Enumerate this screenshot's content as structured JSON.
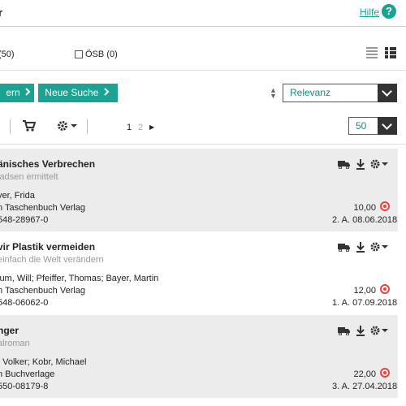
{
  "header": {
    "title": "r",
    "help_link": "Hilfe",
    "help_icon": "?"
  },
  "filters": {
    "first_count": "(50)",
    "osb_label": "ÖSB (0)"
  },
  "actions": {
    "weiter_label": "ern",
    "neue_suche_label": "Neue Suche"
  },
  "sort": {
    "selected": "Relevanz"
  },
  "toolbar": {
    "page_1": "1",
    "page_2": "2",
    "per_page": "50"
  },
  "results": [
    {
      "title": "änisches Verbrechen",
      "subtitle": "ladsen ermittelt",
      "authors": "ver, Frida",
      "publisher": "n Taschenbuch Verlag",
      "isbn": "548-28967-0",
      "price": "10,00",
      "edition": "2. A. 08.06.2018"
    },
    {
      "title": "vir Plastik vermeiden",
      "subtitle": "einfach die Welt verändern",
      "authors": "lum, Will; Pfeiffer, Thomas; Bayer, Martin",
      "publisher": "n Taschenbuch Verlag",
      "isbn": "548-06062-0",
      "price": "12,00",
      "edition": "1. A. 07.09.2018"
    },
    {
      "title": "nger",
      "subtitle": "alroman",
      "authors": ", Volker; Kobr, Michael",
      "publisher": "n Buchverlage",
      "isbn": "550-08179-8",
      "price": "22,00",
      "edition": "3. A. 27.04.2018"
    }
  ],
  "colors": {
    "accent": "#1aa392",
    "status": "#e9443a"
  }
}
